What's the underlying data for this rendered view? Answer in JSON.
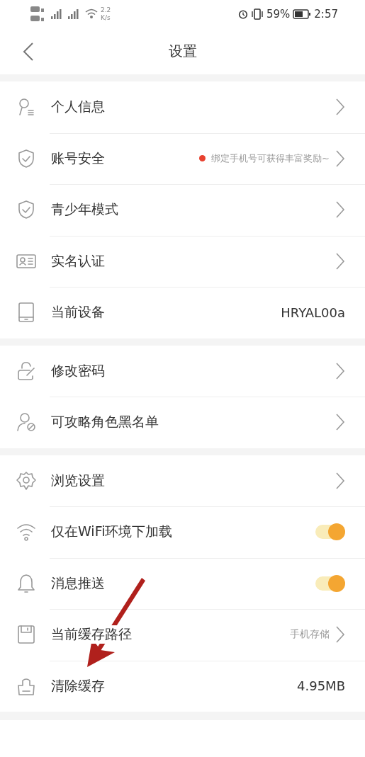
{
  "status_bar": {
    "speed": "2.2",
    "speed_unit": "K/s",
    "battery": "59%",
    "time": "2:57"
  },
  "header": {
    "title": "设置"
  },
  "sections": [
    {
      "rows": [
        {
          "kind": "link",
          "label": "个人信息"
        },
        {
          "kind": "link",
          "label": "账号安全",
          "notice": "绑定手机号可获得丰富奖励~"
        },
        {
          "kind": "link",
          "label": "青少年模式"
        },
        {
          "kind": "link",
          "label": "实名认证"
        },
        {
          "kind": "value",
          "label": "当前设备",
          "value": "HRYAL00a"
        }
      ]
    },
    {
      "rows": [
        {
          "kind": "link",
          "label": "修改密码"
        },
        {
          "kind": "link",
          "label": "可攻略角色黑名单"
        }
      ]
    },
    {
      "rows": [
        {
          "kind": "link",
          "label": "浏览设置"
        },
        {
          "kind": "toggle",
          "label": "仅在WiFi环境下加载",
          "on": true
        },
        {
          "kind": "toggle",
          "label": "消息推送",
          "on": true
        },
        {
          "kind": "link",
          "label": "当前缓存路径",
          "value": "手机存储"
        },
        {
          "kind": "value",
          "label": "清除缓存",
          "value": "4.95MB"
        }
      ]
    }
  ]
}
